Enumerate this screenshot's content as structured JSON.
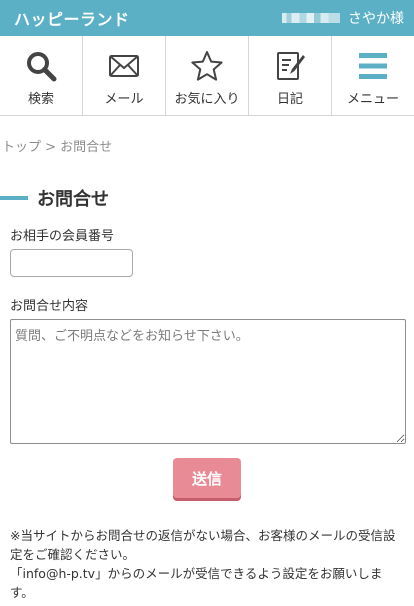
{
  "colors": {
    "brand": "#5bb0c6",
    "accent": "#e88b95"
  },
  "header": {
    "logo": "ハッピーランド",
    "user_name": "さやか様"
  },
  "nav": [
    {
      "label": "検索",
      "icon": "search-icon"
    },
    {
      "label": "メール",
      "icon": "mail-icon"
    },
    {
      "label": "お気に入り",
      "icon": "star-icon"
    },
    {
      "label": "日記",
      "icon": "diary-icon"
    },
    {
      "label": "メニュー",
      "icon": "menu-icon"
    }
  ],
  "breadcrumb": "トップ > お問合せ",
  "page_title": "お問合せ",
  "form": {
    "member_label": "お相手の会員番号",
    "member_value": "",
    "inquiry_label": "お問合せ内容",
    "inquiry_placeholder": "質問、ご不明点などをお知らせ下さい。",
    "submit_label": "送信"
  },
  "notice": {
    "line1": "※当サイトからお問合せの返信がない場合、お客様のメールの受信設定をご確認ください。",
    "line2": "「info@h-p.tv」からのメールが受信できるよう設定をお願いします。"
  }
}
